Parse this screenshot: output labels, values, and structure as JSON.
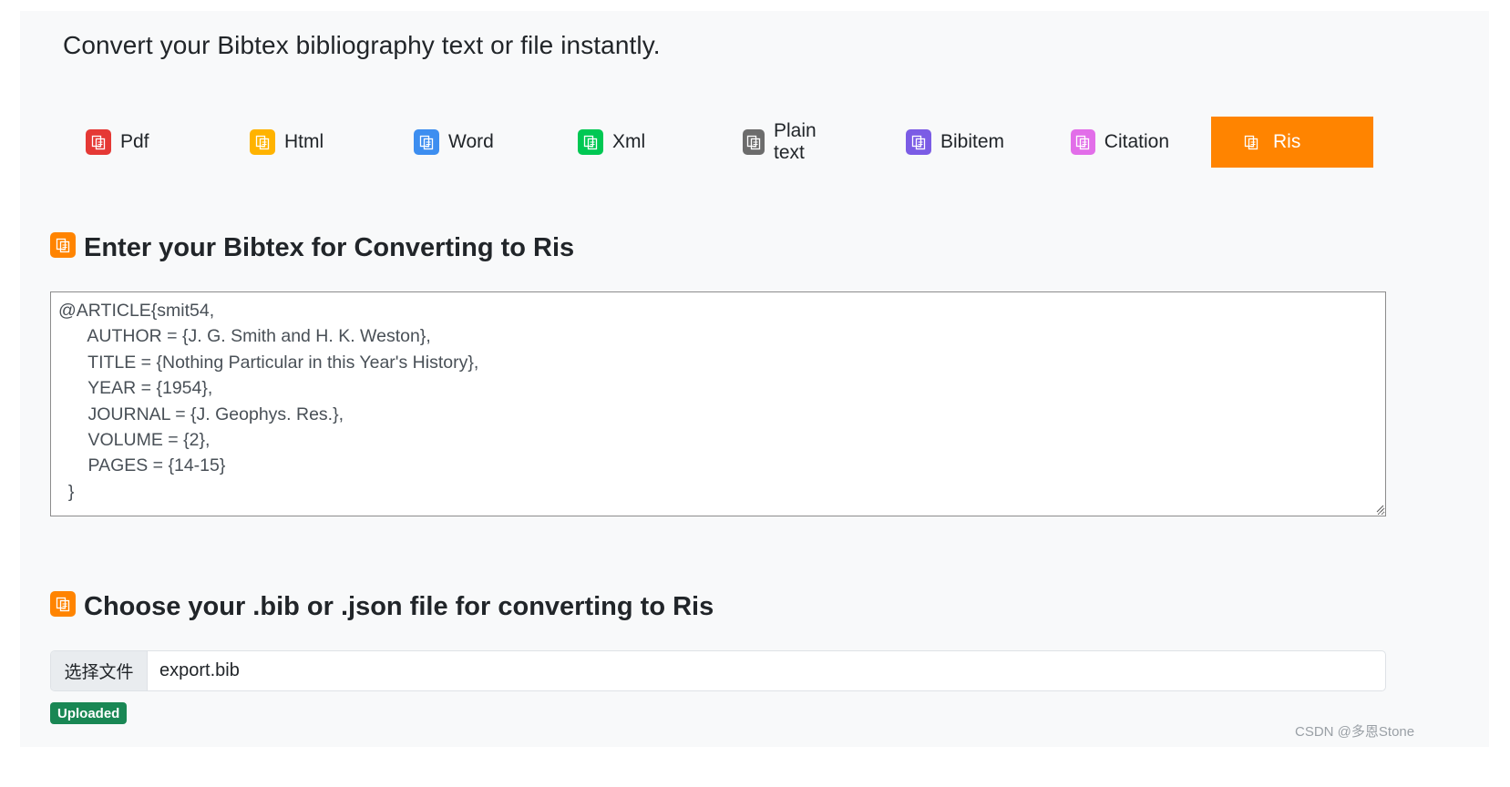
{
  "headline": "Convert your Bibtex bibliography text or file instantly.",
  "tabs": [
    {
      "label": "Pdf",
      "icon": "copy-icon",
      "color": "#e53935"
    },
    {
      "label": "Html",
      "icon": "copy-icon",
      "color": "#ffb300"
    },
    {
      "label": "Word",
      "icon": "copy-icon",
      "color": "#3d8ef0"
    },
    {
      "label": "Xml",
      "icon": "copy-icon",
      "color": "#00c853"
    },
    {
      "label": "Plain text",
      "icon": "copy-icon",
      "color": "#6c6c6c"
    },
    {
      "label": "Bibitem",
      "icon": "copy-icon",
      "color": "#7b5ce5"
    },
    {
      "label": "Citation",
      "icon": "copy-icon",
      "color": "#e26ee9"
    },
    {
      "label": "Ris",
      "icon": "copy-icon",
      "color": "#ff8400",
      "active": true
    }
  ],
  "enter_section": {
    "title": "Enter your Bibtex for Converting to Ris",
    "icon": "copy-icon",
    "textarea_value": "@ARTICLE{smit54,\n      AUTHOR = {J. G. Smith and H. K. Weston},\n      TITLE = {Nothing Particular in this Year's History},\n      YEAR = {1954},\n      JOURNAL = {J. Geophys. Res.},\n      VOLUME = {2},\n      PAGES = {14-15}\n  }"
  },
  "file_section": {
    "title": "Choose your .bib or .json file for converting to Ris",
    "icon": "copy-icon",
    "choose_button": "选择文件",
    "file_name": "export.bib",
    "status_badge": "Uploaded"
  },
  "watermark": "CSDN @多恩Stone",
  "colors": {
    "accent": "#ff8400",
    "success": "#198754",
    "panel_bg": "#f8f9fa"
  }
}
